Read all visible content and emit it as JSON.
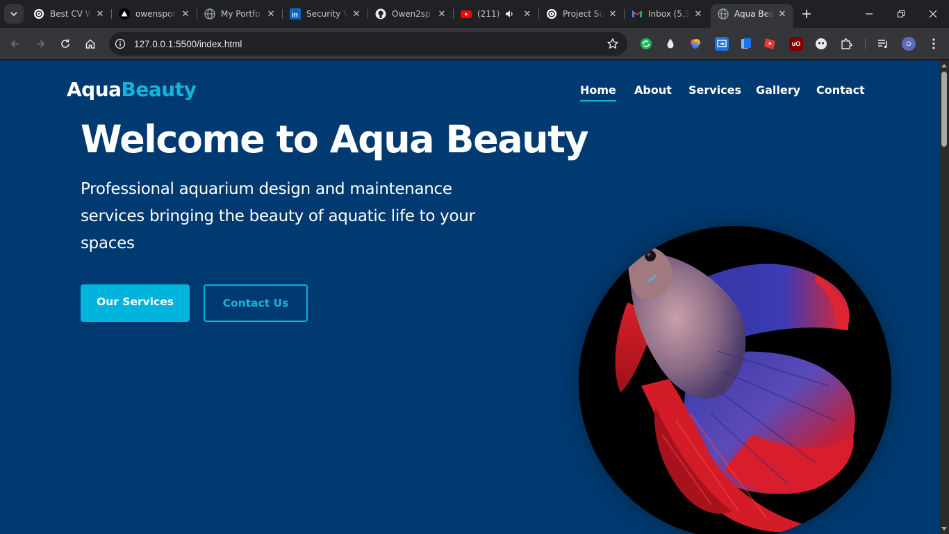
{
  "browser": {
    "tabs": [
      {
        "title": "Best CV W",
        "icon": "openai-icon"
      },
      {
        "title": "owenspor",
        "icon": "vercel-icon"
      },
      {
        "title": "My Portfo",
        "icon": "globe-icon"
      },
      {
        "title": "Security V",
        "icon": "linkedin-icon"
      },
      {
        "title": "Owen2sp",
        "icon": "github-icon"
      },
      {
        "title": "(211)",
        "icon": "youtube-icon"
      },
      {
        "title": "Project Su",
        "icon": "openai-icon"
      },
      {
        "title": "Inbox (5,5",
        "icon": "gmail-icon"
      },
      {
        "title": "Aqua Bea",
        "icon": "globe-icon",
        "active": true
      }
    ],
    "address_bar": {
      "url": "127.0.0.1:5500/index.html"
    },
    "profile_initial": "O"
  },
  "site": {
    "logo": {
      "part1": "Aqua",
      "part2": "Beauty"
    },
    "nav": [
      "Home",
      "About",
      "Services",
      "Gallery",
      "Contact"
    ],
    "active_nav": "Home",
    "hero": {
      "title": "Welcome to Aqua Beauty",
      "subtitle": "Professional aquarium design and maintenance services bringing the beauty of aquatic life to your spaces",
      "primary_button": "Our Services",
      "secondary_button": "Contact Us"
    },
    "hero_image": "betta-fish-image"
  },
  "colors": {
    "page_background": "#003a70",
    "accent": "#00b4db",
    "browser_frame": "#202124",
    "toolbar": "#35363a"
  }
}
